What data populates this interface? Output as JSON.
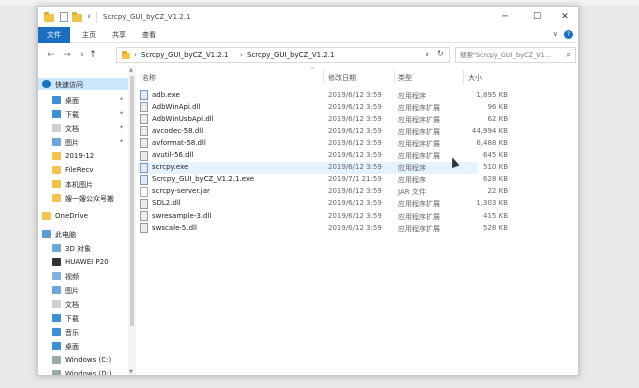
{
  "window": {
    "title": "Scrcpy_GUI_byCZ_V1.2.1",
    "controls": {
      "minimize": "─",
      "maximize": "☐",
      "close": "✕"
    }
  },
  "ribbon": {
    "tabs": [
      "文件",
      "主页",
      "共享",
      "查看"
    ],
    "expand": "∨",
    "help": "?"
  },
  "nav": {
    "back": "←",
    "forward": "→",
    "recent": "∨",
    "up": "↑",
    "breadcrumb": [
      "Scrcpy_GUI_byCZ_V1.2.1",
      "Scrcpy_GUI_byCZ_V1.2.1"
    ],
    "breadcrumb_sep": "›",
    "dropdown": "∨",
    "refresh": "↻",
    "search_placeholder": "搜索\"Scrcpy_GUI_byCZ_V1..."
  },
  "sidebar": {
    "items": [
      {
        "label": "快速访问",
        "icon": "star-icon",
        "pinned": false,
        "selected": true
      },
      {
        "label": "桌面",
        "icon": "desktop-icon",
        "pinned": true,
        "selected": false
      },
      {
        "label": "下载",
        "icon": "download-icon",
        "pinned": true,
        "selected": false
      },
      {
        "label": "文档",
        "icon": "document-icon",
        "pinned": true,
        "selected": false
      },
      {
        "label": "图片",
        "icon": "picture-icon",
        "pinned": true,
        "selected": false
      },
      {
        "label": "2019-12",
        "icon": "folder-icon",
        "pinned": false,
        "selected": false
      },
      {
        "label": "FileRecv",
        "icon": "folder-icon",
        "pinned": false,
        "selected": false
      },
      {
        "label": "本机图片",
        "icon": "folder-icon",
        "pinned": false,
        "selected": false
      },
      {
        "label": "嫂一嫂公众号搬",
        "icon": "folder-icon",
        "pinned": false,
        "selected": false
      },
      {
        "label": "OneDrive",
        "icon": "onedrive-folder-icon",
        "pinned": false,
        "selected": false
      },
      {
        "label": "此电脑",
        "icon": "computer-icon",
        "pinned": false,
        "selected": false
      },
      {
        "label": "3D 对象",
        "icon": "cube-icon",
        "pinned": false,
        "selected": false
      },
      {
        "label": "HUAWEI P20",
        "icon": "phone-icon",
        "pinned": false,
        "selected": false
      },
      {
        "label": "视频",
        "icon": "video-icon",
        "pinned": false,
        "selected": false
      },
      {
        "label": "图片",
        "icon": "picture-icon",
        "pinned": false,
        "selected": false
      },
      {
        "label": "文档",
        "icon": "document-icon",
        "pinned": false,
        "selected": false
      },
      {
        "label": "下载",
        "icon": "download-icon",
        "pinned": false,
        "selected": false
      },
      {
        "label": "音乐",
        "icon": "music-icon",
        "pinned": false,
        "selected": false
      },
      {
        "label": "桌面",
        "icon": "desktop-icon",
        "pinned": false,
        "selected": false
      },
      {
        "label": "Windows (C:)",
        "icon": "drive-icon",
        "pinned": false,
        "selected": false
      },
      {
        "label": "Windows (D:)",
        "icon": "drive-icon",
        "pinned": false,
        "selected": false
      }
    ]
  },
  "columns": {
    "name": "名称",
    "date": "修改日期",
    "type": "类型",
    "size": "大小",
    "sort_indicator": "^"
  },
  "files": [
    {
      "name": "adb.exe",
      "date": "2019/6/12 3:59",
      "type": "应用程序",
      "size": "1,895 KB",
      "kind": "exe",
      "selected": false
    },
    {
      "name": "AdbWinApi.dll",
      "date": "2019/6/12 3:59",
      "type": "应用程序扩展",
      "size": "96 KB",
      "kind": "dll",
      "selected": false
    },
    {
      "name": "AdbWinUsbApi.dll",
      "date": "2019/6/12 3:59",
      "type": "应用程序扩展",
      "size": "62 KB",
      "kind": "dll",
      "selected": false
    },
    {
      "name": "avcodec-58.dll",
      "date": "2019/6/12 3:59",
      "type": "应用程序扩展",
      "size": "44,994 KB",
      "kind": "dll",
      "selected": false
    },
    {
      "name": "avformat-58.dll",
      "date": "2019/6/12 3:59",
      "type": "应用程序扩展",
      "size": "6,488 KB",
      "kind": "dll",
      "selected": false
    },
    {
      "name": "avutil-56.dll",
      "date": "2019/6/12 3:59",
      "type": "应用程序扩展",
      "size": "645 KB",
      "kind": "dll",
      "selected": false
    },
    {
      "name": "scrcpy.exe",
      "date": "2019/6/12 3:59",
      "type": "应用程序",
      "size": "510 KB",
      "kind": "exe",
      "selected": true
    },
    {
      "name": "Scrcpy_GUI_byCZ_V1.2.1.exe",
      "date": "2019/7/1 21:59",
      "type": "应用程序",
      "size": "628 KB",
      "kind": "exe",
      "selected": false
    },
    {
      "name": "scrcpy-server.jar",
      "date": "2019/6/12 3:59",
      "type": "JAR 文件",
      "size": "22 KB",
      "kind": "jar",
      "selected": false
    },
    {
      "name": "SDL2.dll",
      "date": "2019/6/12 3:59",
      "type": "应用程序扩展",
      "size": "1,303 KB",
      "kind": "dll",
      "selected": false
    },
    {
      "name": "swresample-3.dll",
      "date": "2019/6/12 3:59",
      "type": "应用程序扩展",
      "size": "415 KB",
      "kind": "dll",
      "selected": false
    },
    {
      "name": "swscale-5.dll",
      "date": "2019/6/12 3:59",
      "type": "应用程序扩展",
      "size": "528 KB",
      "kind": "dll",
      "selected": false
    }
  ],
  "colors": {
    "accent": "#1b6fc2",
    "selected_row": "#e5f3ff",
    "selected_nav": "#cce8ff",
    "folder": "#f3c44a"
  }
}
